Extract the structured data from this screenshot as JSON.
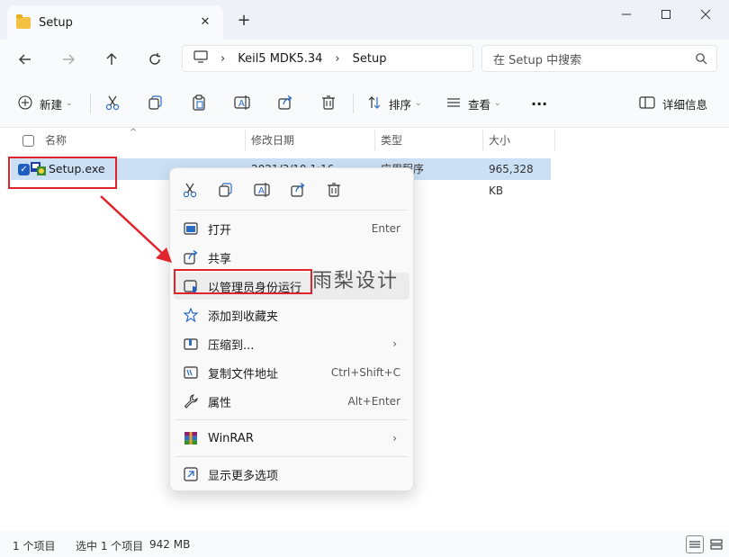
{
  "window": {
    "tab_title": "Setup",
    "new_tab": "+"
  },
  "address": {
    "crumbs": [
      "Keil5 MDK5.34",
      "Setup"
    ],
    "search_placeholder": "在 Setup 中搜索"
  },
  "toolbar": {
    "new_label": "新建",
    "sort_label": "排序",
    "view_label": "查看",
    "more_label": "···",
    "details_label": "详细信息"
  },
  "columns": {
    "name": "名称",
    "date": "修改日期",
    "type": "类型",
    "size": "大小"
  },
  "file": {
    "name": "Setup.exe",
    "date": "2021/3/10 1:16",
    "type": "应用程序",
    "size": "965,328 KB"
  },
  "context_menu": {
    "items": [
      {
        "label": "打开",
        "shortcut": "Enter"
      },
      {
        "label": "共享",
        "shortcut": ""
      },
      {
        "label": "以管理员身份运行",
        "shortcut": ""
      },
      {
        "label": "添加到收藏夹",
        "shortcut": ""
      },
      {
        "label": "压缩到...",
        "shortcut": ""
      },
      {
        "label": "复制文件地址",
        "shortcut": "Ctrl+Shift+C"
      },
      {
        "label": "属性",
        "shortcut": "Alt+Enter"
      },
      {
        "label": "WinRAR",
        "shortcut": ""
      },
      {
        "label": "显示更多选项",
        "shortcut": ""
      }
    ]
  },
  "watermark": "雨梨设计",
  "status": {
    "item_count": "1 个项目",
    "selected": "选中 1 个项目",
    "selected_size": "942 MB"
  },
  "colors": {
    "accent": "#1f5fbf",
    "selection": "#cce0f5",
    "highlight_box": "#e0242c"
  }
}
